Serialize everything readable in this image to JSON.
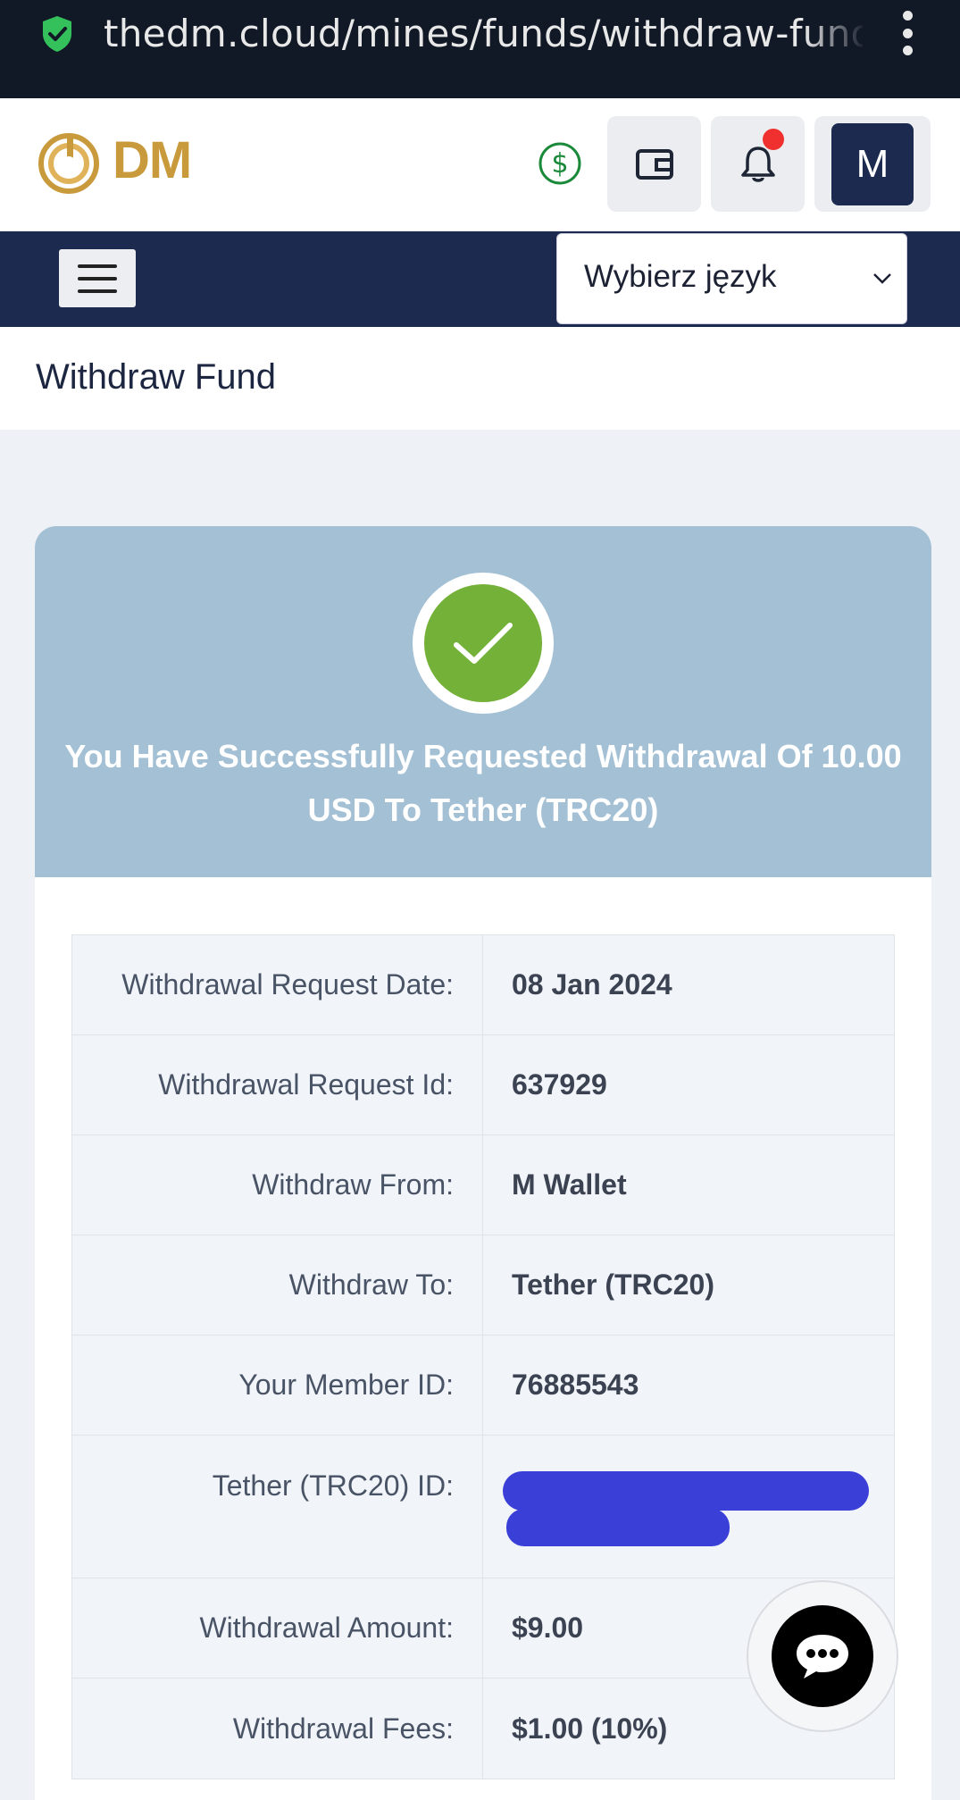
{
  "browser": {
    "url": "thedm.cloud/mines/funds/withdraw-fund/"
  },
  "header": {
    "logo_text": "DM",
    "avatar_letter": "M"
  },
  "nav": {
    "language_select_label": "Wybierz język"
  },
  "page": {
    "title": "Withdraw Fund"
  },
  "success": {
    "message": "You Have Successfully Requested Withdrawal Of 10.00 USD To Tether (TRC20)"
  },
  "details": [
    {
      "label": "Withdrawal Request Date:",
      "value": "08 Jan 2024"
    },
    {
      "label": "Withdrawal Request Id:",
      "value": "637929"
    },
    {
      "label": "Withdraw From:",
      "value": "M Wallet"
    },
    {
      "label": "Withdraw To:",
      "value": "Tether (TRC20)"
    },
    {
      "label": "Your Member ID:",
      "value": "76885543"
    },
    {
      "label": "Tether (TRC20) ID:",
      "value": ""
    },
    {
      "label": "Withdrawal Amount:",
      "value": "$9.00"
    },
    {
      "label": "Withdrawal Fees:",
      "value": "$1.00 (10%)"
    }
  ],
  "colors": {
    "navy": "#1b2a4e",
    "gold": "#c99a3b",
    "success_green": "#74b139",
    "card_header": "#a4c0d5",
    "notification_dot": "#f0302f",
    "redaction": "#3a3fd8"
  },
  "icons": {
    "url_security": "shield-check-icon",
    "currency": "dollar-circle-icon",
    "wallet": "wallet-icon",
    "notifications": "bell-icon",
    "menu": "hamburger-icon",
    "success": "check-icon",
    "chat": "chat-bubble-icon"
  }
}
